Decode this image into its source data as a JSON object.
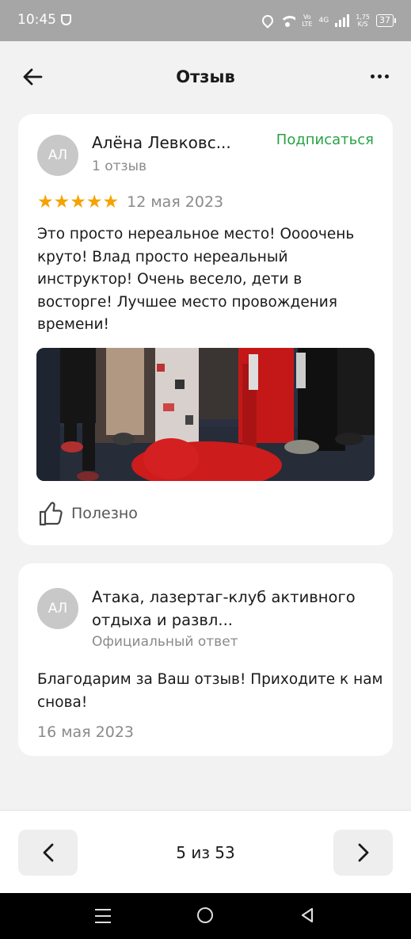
{
  "status_bar": {
    "time": "10:45",
    "net_top": "Vo",
    "net_bottom": "LTE",
    "net_type": "4G",
    "speed_top": "1,75",
    "speed_bottom": "K/S",
    "battery": "37"
  },
  "app_bar": {
    "title": "Отзыв",
    "back_icon": "arrow-left-icon",
    "more_icon": "more-dots-icon"
  },
  "review": {
    "avatar_initials": "АЛ",
    "author": "Алёна Левковс...",
    "author_reviews": "1 отзыв",
    "subscribe_label": "Подписаться",
    "rating": 5,
    "rating_max": 5,
    "star_glyph": "★",
    "date": "12 мая 2023",
    "text": "Это просто нереальное место! Оооочень круто! Влад просто нереальный инструктор! Очень весело, дети в восторге! Лучшее место провождения времени!",
    "helpful_label": "Полезно"
  },
  "reply": {
    "avatar_initials": "АЛ",
    "org_name": "Атака, лазертаг-клуб активного отдыха и развл...",
    "org_label": "Официальный ответ",
    "text": "Благодарим за Ваш отзыв! Приходите к нам снова!",
    "date": "16 мая 2023"
  },
  "pager": {
    "label": "5 из 53",
    "current": 5,
    "total": 53
  },
  "colors": {
    "accent_green": "#27a244",
    "star": "#f5a300",
    "background": "#f2f2f2",
    "status_bar": "#a6a6a6"
  }
}
